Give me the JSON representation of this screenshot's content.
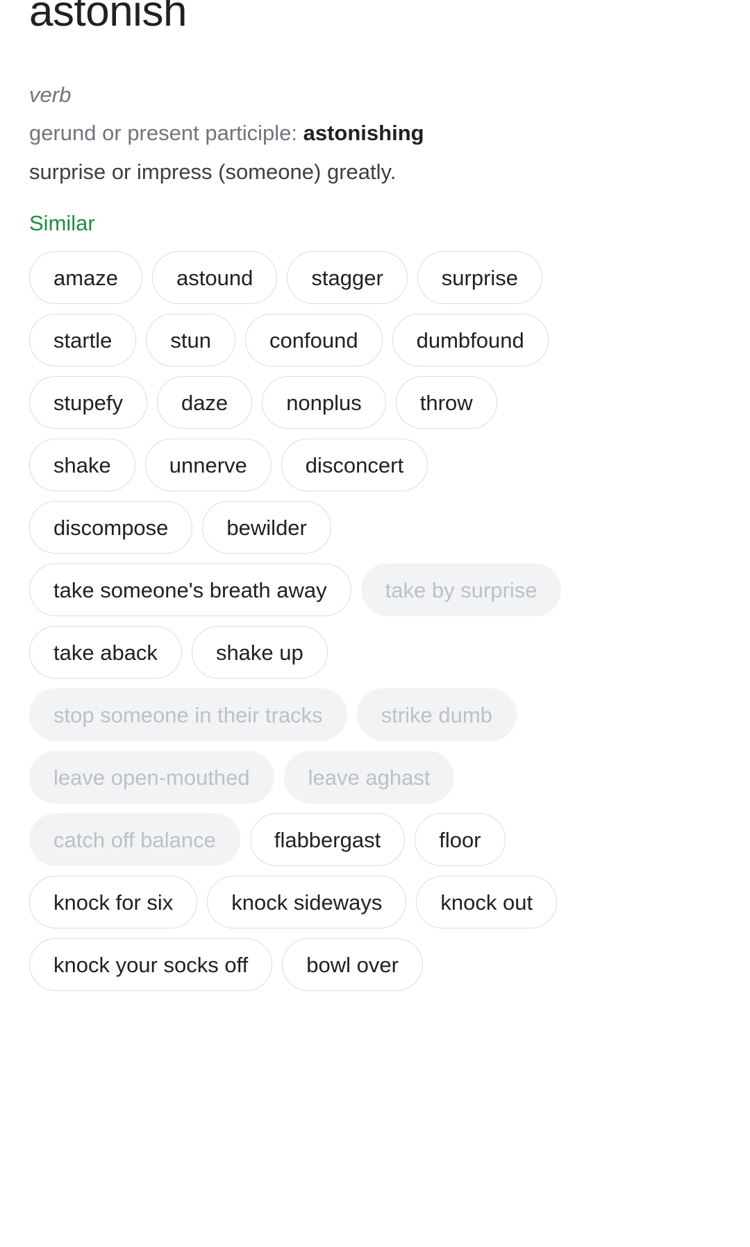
{
  "entry": {
    "headword": "astonish",
    "part_of_speech": "verb",
    "inflection_label": "gerund or present participle: ",
    "inflection_value": "astonishing",
    "sense": "surprise or impress (someone) greatly."
  },
  "similar": {
    "heading": "Similar",
    "heading_color": "#1e8e3e",
    "chip_outlined_border": "#dadce0",
    "chip_outlined_text": "#202124",
    "chip_muted_background": "#f1f3f4",
    "chip_muted_text": "#bdc1c6",
    "chips": [
      {
        "label": "amaze",
        "style": "outlined"
      },
      {
        "label": "astound",
        "style": "outlined"
      },
      {
        "label": "stagger",
        "style": "outlined"
      },
      {
        "label": "surprise",
        "style": "outlined"
      },
      {
        "label": "startle",
        "style": "outlined"
      },
      {
        "label": "stun",
        "style": "outlined"
      },
      {
        "label": "confound",
        "style": "outlined"
      },
      {
        "label": "dumbfound",
        "style": "outlined"
      },
      {
        "label": "stupefy",
        "style": "outlined"
      },
      {
        "label": "daze",
        "style": "outlined"
      },
      {
        "label": "nonplus",
        "style": "outlined"
      },
      {
        "label": "throw",
        "style": "outlined"
      },
      {
        "label": "shake",
        "style": "outlined"
      },
      {
        "label": "unnerve",
        "style": "outlined"
      },
      {
        "label": "disconcert",
        "style": "outlined"
      },
      {
        "label": "discompose",
        "style": "outlined"
      },
      {
        "label": "bewilder",
        "style": "outlined"
      },
      {
        "label": "take someone's breath away",
        "style": "outlined"
      },
      {
        "label": "take by surprise",
        "style": "muted"
      },
      {
        "label": "take aback",
        "style": "outlined"
      },
      {
        "label": "shake up",
        "style": "outlined"
      },
      {
        "label": "stop someone in their tracks",
        "style": "muted"
      },
      {
        "label": "strike dumb",
        "style": "muted"
      },
      {
        "label": "leave open-mouthed",
        "style": "muted"
      },
      {
        "label": "leave aghast",
        "style": "muted"
      },
      {
        "label": "catch off balance",
        "style": "muted"
      },
      {
        "label": "flabbergast",
        "style": "outlined"
      },
      {
        "label": "floor",
        "style": "outlined"
      },
      {
        "label": "knock for six",
        "style": "outlined"
      },
      {
        "label": "knock sideways",
        "style": "outlined"
      },
      {
        "label": "knock out",
        "style": "outlined"
      },
      {
        "label": "knock your socks off",
        "style": "outlined"
      },
      {
        "label": "bowl over",
        "style": "outlined"
      }
    ]
  }
}
